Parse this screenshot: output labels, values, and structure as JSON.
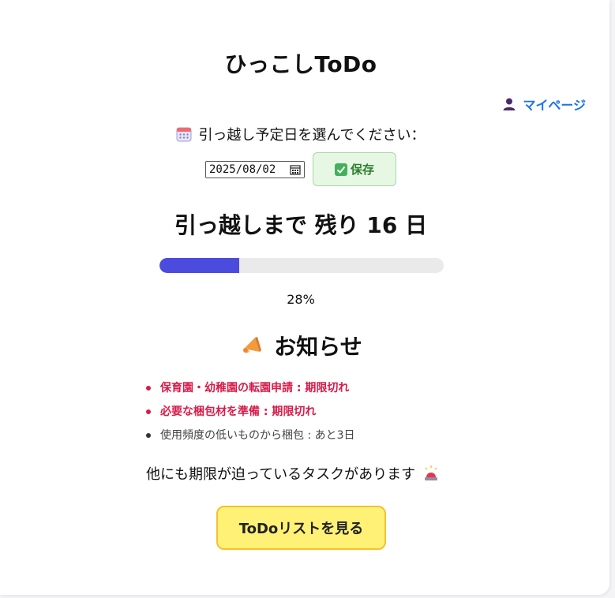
{
  "app": {
    "title": "ひっこしToDo"
  },
  "header": {
    "mypage_label": "マイページ",
    "mypage_icon": "person-icon"
  },
  "moving_date": {
    "prompt": "引っ越し予定日を選んでください：",
    "prompt_icon": "calendar-icon",
    "value": "2025/08/02",
    "save_label": "保存",
    "save_icon": "check-icon"
  },
  "countdown": {
    "text": "引っ越しまで 残り 16 日",
    "progress_percent": 28,
    "progress_text": "28%",
    "progress_color": "#4b4bde"
  },
  "notices": {
    "heading": "お知らせ",
    "heading_icon": "megaphone-icon",
    "items": [
      {
        "text": "保育園・幼稚園の転園申請 : 期限切れ",
        "status": "overdue"
      },
      {
        "text": "必要な梱包材を準備 : 期限切れ",
        "status": "overdue"
      },
      {
        "text": "使用頻度の低いものから梱包 : あと3日",
        "status": "normal"
      }
    ],
    "more_text": "他にも期限が迫っているタスクがあります",
    "more_icon": "siren-icon",
    "overdue_color": "#d81b48"
  },
  "actions": {
    "todo_button_label": "ToDoリストを見る"
  }
}
